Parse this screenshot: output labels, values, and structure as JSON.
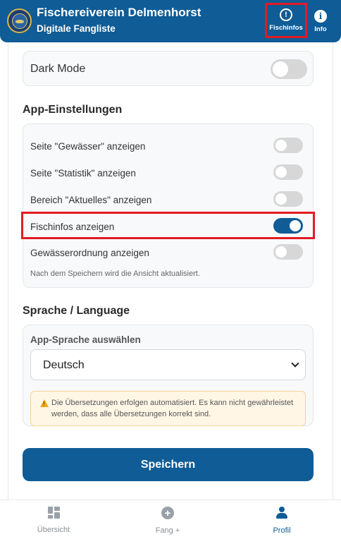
{
  "header": {
    "title": "Fischereiverein Delmenhorst",
    "subtitle": "Digitale Fangliste",
    "fischinfos_label": "Fischinfos",
    "info_label": "Info"
  },
  "dark_mode": {
    "label": "Dark Mode",
    "enabled": false
  },
  "app_settings": {
    "title": "App-Einstellungen",
    "items": [
      {
        "label": "Seite \"Gewässer\" anzeigen",
        "enabled": false
      },
      {
        "label": "Seite \"Statistik\" anzeigen",
        "enabled": false
      },
      {
        "label": "Bereich \"Aktuelles\" anzeigen",
        "enabled": false
      },
      {
        "label": "Fischinfos anzeigen",
        "enabled": true
      },
      {
        "label": "Gewässerordnung anzeigen",
        "enabled": false
      }
    ],
    "note": "Nach dem Speichern wird die Ansicht aktualisiert."
  },
  "language": {
    "title": "Sprache / Language",
    "select_label": "App-Sprache auswählen",
    "selected": "Deutsch",
    "warning": "Die Übersetzungen erfolgen automatisiert. Es kann nicht gewährleistet werden, dass alle Übersetzungen korrekt sind."
  },
  "save_label": "Speichern",
  "nav": {
    "items": [
      {
        "label": "Übersicht",
        "icon": "dashboard-icon",
        "active": false
      },
      {
        "label": "Fang +",
        "icon": "plus-circle-icon",
        "active": false
      },
      {
        "label": "Profil",
        "icon": "user-icon",
        "active": true
      }
    ]
  },
  "colors": {
    "primary": "#0f5c96",
    "highlight": "#e21b23",
    "warning_bg": "#fff6e6"
  }
}
